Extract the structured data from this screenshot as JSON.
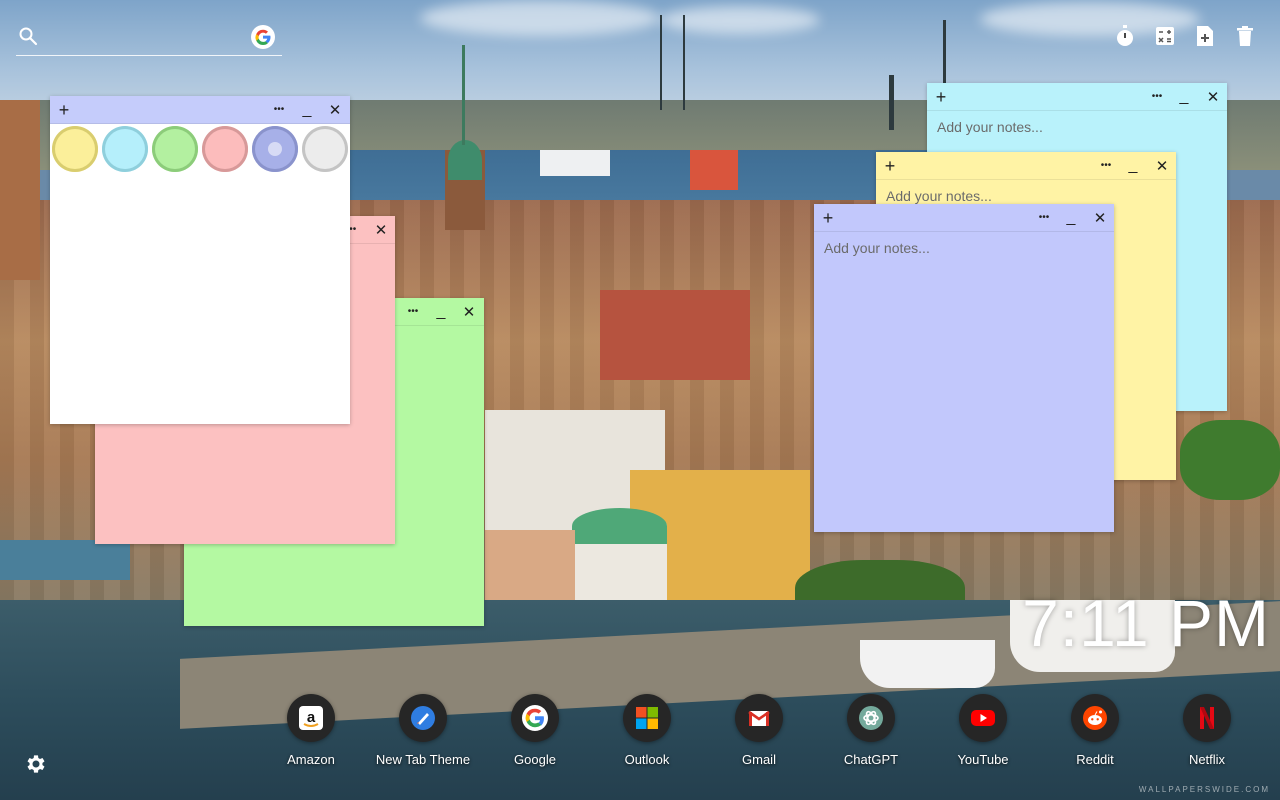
{
  "search": {
    "placeholder": "",
    "engine_icon": "google-icon"
  },
  "top_actions": [
    {
      "name": "timer-icon"
    },
    {
      "name": "calculator-icon"
    },
    {
      "name": "add-note-icon"
    },
    {
      "name": "trash-icon"
    }
  ],
  "notes": {
    "palette_note": {
      "color": "#ffffff",
      "header_color": "#c5ccfb",
      "swatches": [
        {
          "color": "#fbef9a",
          "ring": "#d9cd6f"
        },
        {
          "color": "#b5effb",
          "ring": "#8fcfdc"
        },
        {
          "color": "#b3f0a0",
          "ring": "#8ccc7a"
        },
        {
          "color": "#fcbcbc",
          "ring": "#d79999"
        },
        {
          "color": "#a7b0e8",
          "ring": "#8a93cc",
          "selected": true
        },
        {
          "color": "#ececec",
          "ring": "#c4c4c4"
        }
      ]
    },
    "pink_note": {
      "color": "#fcc1c1"
    },
    "green_note": {
      "color": "#b4f9a2"
    },
    "cyan_note": {
      "color": "#b9f2fb",
      "placeholder": "Add your notes..."
    },
    "yellow_note": {
      "color": "#fff3a5",
      "placeholder": "Add your notes..."
    },
    "lavender_note": {
      "color": "#c2c8fc",
      "placeholder": "Add your notes..."
    }
  },
  "note_controls": {
    "add": "+",
    "menu": "•••",
    "minimize": "_",
    "close": "✕"
  },
  "clock": {
    "time": "7:11 PM"
  },
  "dock": [
    {
      "label": "Amazon",
      "icon": "amazon-icon"
    },
    {
      "label": "New Tab Theme",
      "icon": "new-tab-theme-icon"
    },
    {
      "label": "Google",
      "icon": "google-icon"
    },
    {
      "label": "Outlook",
      "icon": "microsoft-icon"
    },
    {
      "label": "Gmail",
      "icon": "gmail-icon"
    },
    {
      "label": "ChatGPT",
      "icon": "chatgpt-icon"
    },
    {
      "label": "YouTube",
      "icon": "youtube-icon"
    },
    {
      "label": "Reddit",
      "icon": "reddit-icon"
    },
    {
      "label": "Netflix",
      "icon": "netflix-icon"
    }
  ],
  "settings": {
    "icon": "gear-icon"
  },
  "watermark": "WALLPAPERSWIDE.COM"
}
